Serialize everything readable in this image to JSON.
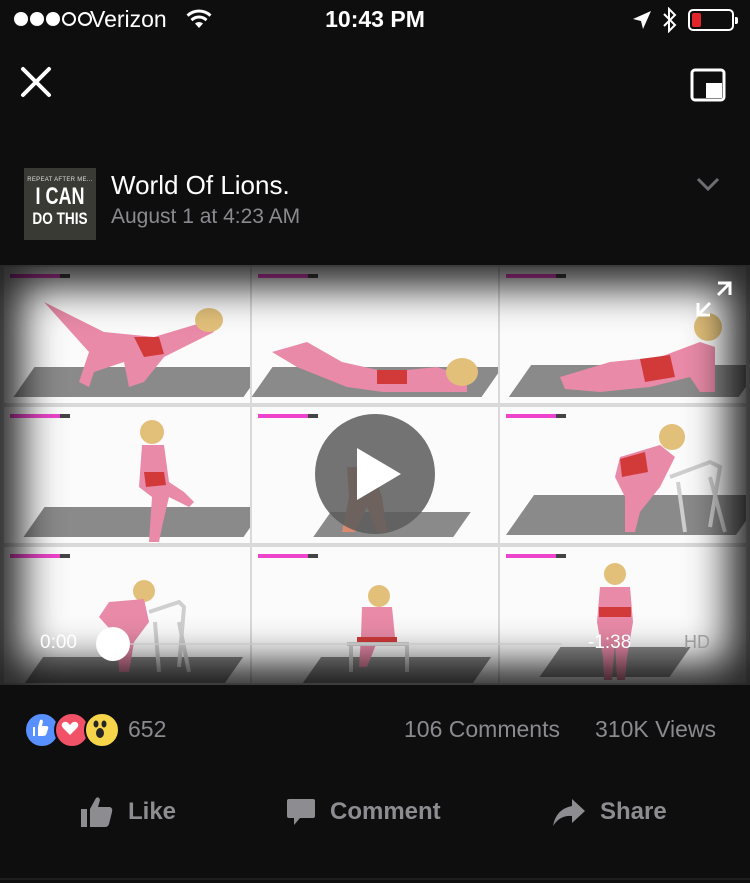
{
  "status_bar": {
    "carrier": "Verizon",
    "time": "10:43 PM",
    "signal_bars_filled": 3,
    "signal_bars_total": 5,
    "battery_level": 0.1,
    "battery_color": "#e0262b",
    "icons": [
      "wifi-icon",
      "location-arrow-icon",
      "bluetooth-icon",
      "battery-icon"
    ]
  },
  "nav": {
    "close_icon": "close-icon",
    "pip_icon": "picture-in-picture-icon"
  },
  "post": {
    "avatar": {
      "line_small": "REPEAT AFTER ME...",
      "line1": "I CAN",
      "line2": "DO THIS"
    },
    "page_name": "World Of Lions.",
    "date": "August 1 at 4:23 AM",
    "menu_icon": "chevron-down-icon"
  },
  "video": {
    "current_time": "0:00",
    "remaining_time": "-1:38",
    "quality_label": "HD",
    "progress": 0.0,
    "play_icon": "play-icon",
    "expand_icon": "expand-icon"
  },
  "stats": {
    "reactions": [
      "like",
      "love",
      "wow"
    ],
    "reaction_colors": {
      "like": "#5890ff",
      "love": "#f25268",
      "wow": "#f7d54b"
    },
    "reaction_count": "652",
    "comments": "106 Comments",
    "views": "310K Views"
  },
  "actions": {
    "like_label": "Like",
    "comment_label": "Comment",
    "share_label": "Share"
  }
}
